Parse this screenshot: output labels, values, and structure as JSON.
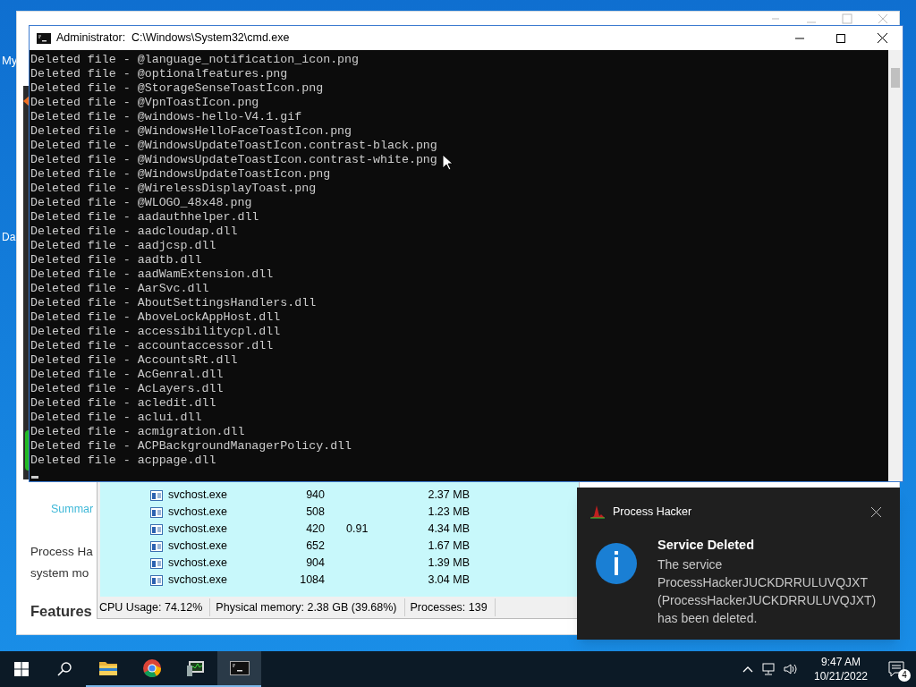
{
  "desktop_icons": [
    {
      "label": "My"
    },
    {
      "label": "Da"
    }
  ],
  "browser": {
    "link": "Summar",
    "paragraph": [
      "Process Ha",
      "system mo"
    ],
    "heading": "Features"
  },
  "process_hacker": {
    "rows": [
      {
        "name": "svchost.exe",
        "pid": "940",
        "cpu": "",
        "memory": "2.37 MB"
      },
      {
        "name": "svchost.exe",
        "pid": "508",
        "cpu": "",
        "memory": "1.23 MB"
      },
      {
        "name": "svchost.exe",
        "pid": "420",
        "cpu": "0.91",
        "memory": "4.34 MB"
      },
      {
        "name": "svchost.exe",
        "pid": "652",
        "cpu": "",
        "memory": "1.67 MB"
      },
      {
        "name": "svchost.exe",
        "pid": "904",
        "cpu": "",
        "memory": "1.39 MB"
      },
      {
        "name": "svchost.exe",
        "pid": "1084",
        "cpu": "",
        "memory": "3.04 MB"
      }
    ],
    "status_bar": [
      "CPU Usage: 74.12%",
      "Physical memory: 2.38 GB (39.68%)",
      "Processes: 139"
    ]
  },
  "cmd": {
    "title": "Administrator:  C:\\Windows\\System32\\cmd.exe",
    "lines": [
      "Deleted file - @language_notification_icon.png",
      "Deleted file - @optionalfeatures.png",
      "Deleted file - @StorageSenseToastIcon.png",
      "Deleted file - @VpnToastIcon.png",
      "Deleted file - @windows-hello-V4.1.gif",
      "Deleted file - @WindowsHelloFaceToastIcon.png",
      "Deleted file - @WindowsUpdateToastIcon.contrast-black.png",
      "Deleted file - @WindowsUpdateToastIcon.contrast-white.png",
      "Deleted file - @WindowsUpdateToastIcon.png",
      "Deleted file - @WirelessDisplayToast.png",
      "Deleted file - @WLOGO_48x48.png",
      "Deleted file - aadauthhelper.dll",
      "Deleted file - aadcloudap.dll",
      "Deleted file - aadjcsp.dll",
      "Deleted file - aadtb.dll",
      "Deleted file - aadWamExtension.dll",
      "Deleted file - AarSvc.dll",
      "Deleted file - AboutSettingsHandlers.dll",
      "Deleted file - AboveLockAppHost.dll",
      "Deleted file - accessibilitycpl.dll",
      "Deleted file - accountaccessor.dll",
      "Deleted file - AccountsRt.dll",
      "Deleted file - AcGenral.dll",
      "Deleted file - AcLayers.dll",
      "Deleted file - acledit.dll",
      "Deleted file - aclui.dll",
      "Deleted file - acmigration.dll",
      "Deleted file - ACPBackgroundManagerPolicy.dll",
      "Deleted file - acppage.dll"
    ]
  },
  "notification": {
    "app": "Process Hacker",
    "title": "Service Deleted",
    "body": "The service ProcessHackerJUCKDRRULUVQJXT (ProcessHackerJUCKDRRULUVQJXT) has been deleted."
  },
  "taskbar": {
    "apps": [
      {
        "kind": "folder",
        "selected": false
      },
      {
        "kind": "chrome",
        "selected": false
      },
      {
        "kind": "processhacker",
        "selected": false
      },
      {
        "kind": "cmd",
        "selected": true
      }
    ],
    "time": "9:47 AM",
    "date": "10/21/2022",
    "notification_count": "4"
  }
}
